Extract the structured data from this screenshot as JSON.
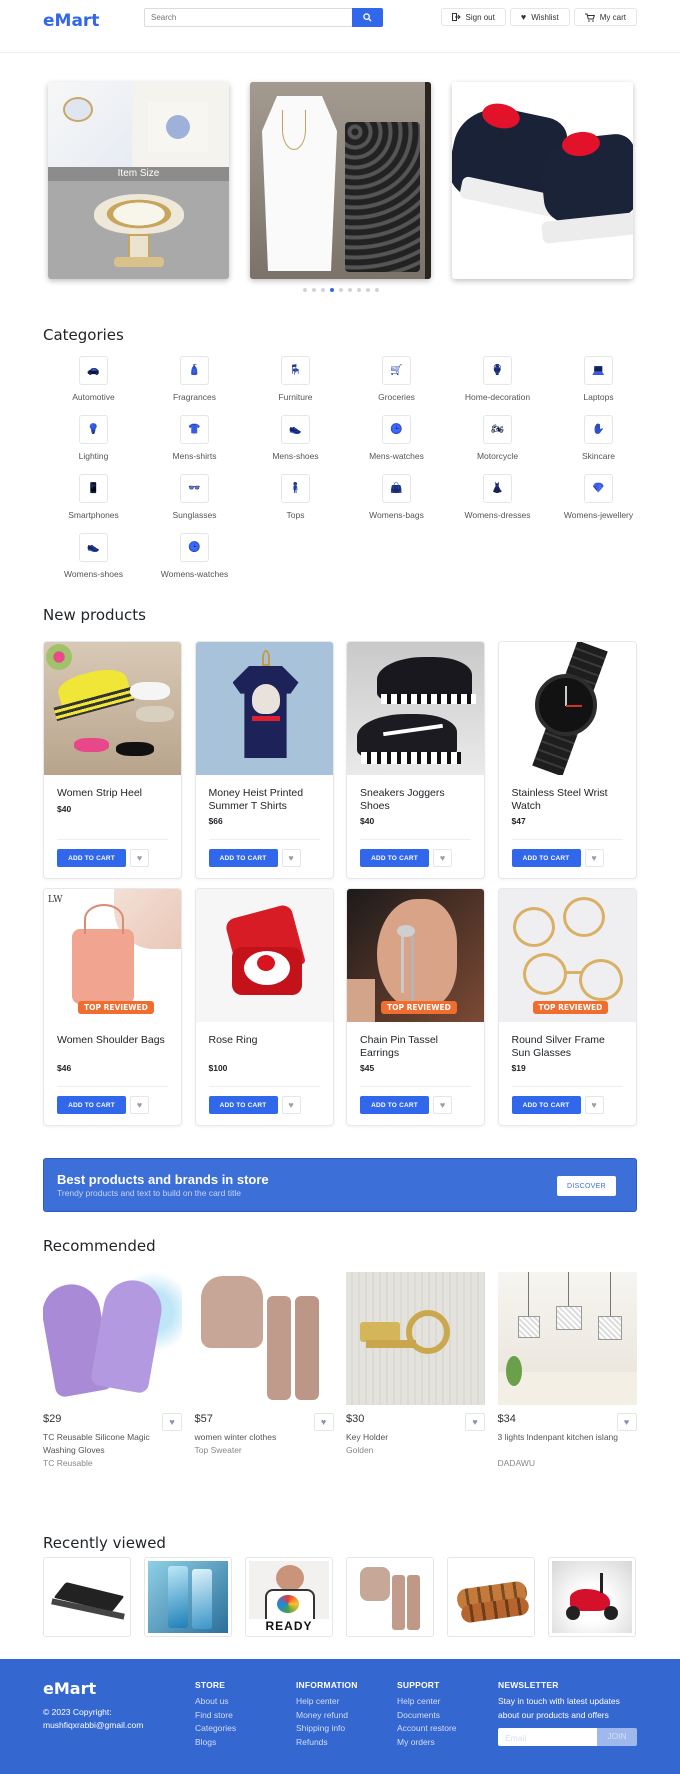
{
  "header": {
    "brand": "eMart",
    "search_placeholder": "Search",
    "sign_out": "Sign out",
    "wishlist": "Wishlist",
    "cart": "My cart"
  },
  "banner": {
    "slide1_caption": "Item Size"
  },
  "categories": {
    "title": "Categories",
    "items": [
      {
        "label": "Automotive",
        "icon": "car-icon",
        "glyph": "🚗"
      },
      {
        "label": "Fragrances",
        "icon": "perfume-icon",
        "glyph": "🧴"
      },
      {
        "label": "Furniture",
        "icon": "chair-icon",
        "glyph": "🪑"
      },
      {
        "label": "Groceries",
        "icon": "cart-icon",
        "glyph": "🛒"
      },
      {
        "label": "Home-decoration",
        "icon": "vase-icon",
        "glyph": "🏺"
      },
      {
        "label": "Laptops",
        "icon": "laptop-icon",
        "glyph": "💻"
      },
      {
        "label": "Lighting",
        "icon": "bulb-icon",
        "glyph": "💡"
      },
      {
        "label": "Mens-shirts",
        "icon": "shirt-icon",
        "glyph": "👕"
      },
      {
        "label": "Mens-shoes",
        "icon": "shoe-icon",
        "glyph": "👟"
      },
      {
        "label": "Mens-watches",
        "icon": "clock-icon",
        "glyph": "🕒"
      },
      {
        "label": "Motorcycle",
        "icon": "motorcycle-icon",
        "glyph": "🏍"
      },
      {
        "label": "Skincare",
        "icon": "hand-icon",
        "glyph": "✋"
      },
      {
        "label": "Smartphones",
        "icon": "phone-icon",
        "glyph": "📱"
      },
      {
        "label": "Sunglasses",
        "icon": "glasses-icon",
        "glyph": "👓"
      },
      {
        "label": "Tops",
        "icon": "person-icon",
        "glyph": "🧍"
      },
      {
        "label": "Womens-bags",
        "icon": "bag-icon",
        "glyph": "👜"
      },
      {
        "label": "Womens-dresses",
        "icon": "dress-icon",
        "glyph": "👗"
      },
      {
        "label": "Womens-jewellery",
        "icon": "gem-icon",
        "glyph": "💎"
      },
      {
        "label": "Womens-shoes",
        "icon": "shoe-icon",
        "glyph": "👟"
      },
      {
        "label": "Womens-watches",
        "icon": "clock-icon",
        "glyph": "🕒"
      }
    ]
  },
  "new_products": {
    "title": "New products",
    "add_label": "ADD TO CART",
    "badge_label": "TOP REVIEWED",
    "items": [
      {
        "name": "Women Strip Heel",
        "price": "$40"
      },
      {
        "name": "Money Heist Printed Summer T Shirts",
        "price": "$66"
      },
      {
        "name": "Sneakers Joggers Shoes",
        "price": "$40"
      },
      {
        "name": "Stainless Steel Wrist Watch",
        "price": "$47"
      },
      {
        "name": "Women Shoulder Bags",
        "price": "$46"
      },
      {
        "name": "Rose Ring",
        "price": "$100"
      },
      {
        "name": "Chain Pin Tassel Earrings",
        "price": "$45"
      },
      {
        "name": "Round Silver Frame Sun Glasses",
        "price": "$19"
      }
    ]
  },
  "promo": {
    "title": "Best products and brands in store",
    "subtitle": "Trendy products and text to build on the card title",
    "button": "DISCOVER"
  },
  "recommended": {
    "title": "Recommended",
    "items": [
      {
        "price": "$29",
        "desc": "TC Reusable Silicone Magic Washing Gloves",
        "brand": "TC Reusable"
      },
      {
        "price": "$57",
        "desc": "women winter clothes",
        "brand": "Top Sweater"
      },
      {
        "price": "$30",
        "desc": "Key Holder",
        "brand": "Golden"
      },
      {
        "price": "$34",
        "desc": "3 lights lndenpant kitchen islang",
        "brand": "DADAWU"
      }
    ]
  },
  "recently_viewed": {
    "title": "Recently viewed",
    "ready_text": "READY"
  },
  "footer": {
    "brand": "eMart",
    "copyright": "© 2023 Copyright: mushfiqxrabbi@gmail.com",
    "store": {
      "title": "STORE",
      "links": [
        "About us",
        "Find store",
        "Categories",
        "Blogs"
      ]
    },
    "information": {
      "title": "INFORMATION",
      "links": [
        "Help center",
        "Money refund",
        "Shipping info",
        "Refunds"
      ]
    },
    "support": {
      "title": "SUPPORT",
      "links": [
        "Help center",
        "Documents",
        "Account restore",
        "My orders"
      ]
    },
    "newsletter": {
      "title": "NEWSLETTER",
      "text": "Stay in touch with latest updates about our products and offers",
      "placeholder": "Email",
      "button": "JOIN"
    }
  }
}
